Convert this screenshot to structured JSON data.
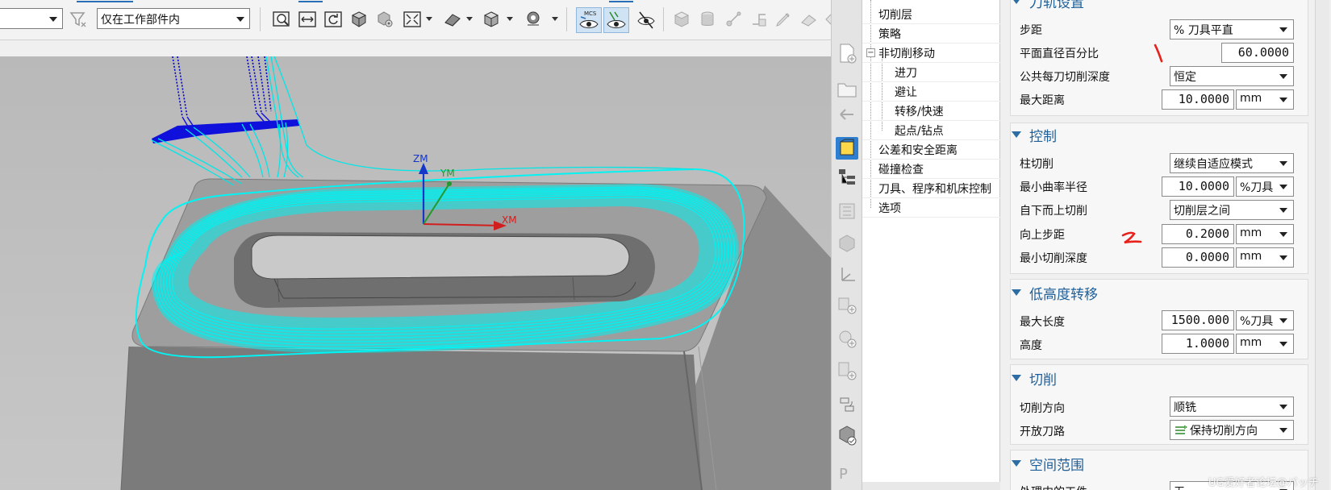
{
  "toolbar": {
    "filter_combo_value": "",
    "scope_combo_value": "仅在工作部件内",
    "mcs_label": "MCS"
  },
  "viewport": {
    "axis_zm": "ZM",
    "axis_ym": "YM",
    "axis_xm": "XM"
  },
  "navigator": {
    "items": [
      {
        "label": "切削层",
        "level": 0
      },
      {
        "label": "策略",
        "level": 0
      },
      {
        "label": "非切削移动",
        "level": 0,
        "expanded": true
      },
      {
        "label": "进刀",
        "level": 1
      },
      {
        "label": "避让",
        "level": 1
      },
      {
        "label": "转移/快速",
        "level": 1
      },
      {
        "label": "起点/钻点",
        "level": 1
      },
      {
        "label": "公差和安全距离",
        "level": 0
      },
      {
        "label": "碰撞检查",
        "level": 0
      },
      {
        "label": "刀具、程序和机床控制",
        "level": 0
      },
      {
        "label": "选项",
        "level": 0
      }
    ]
  },
  "dialog": {
    "sections": {
      "toolpath": {
        "title": "刀轨设置",
        "stepover_label": "步距",
        "stepover_value": "% 刀具平直",
        "flat_pct_label": "平面直径百分比",
        "flat_pct_value": "60.0000",
        "common_depth_label": "公共每刀切削深度",
        "common_depth_value": "恒定",
        "max_dist_label": "最大距离",
        "max_dist_value": "10.0000",
        "max_dist_unit": "mm"
      },
      "control": {
        "title": "控制",
        "column_cut_label": "柱切削",
        "column_cut_value": "继续自适应模式",
        "min_radius_label": "最小曲率半径",
        "min_radius_value": "10.0000",
        "min_radius_unit": "%刀具",
        "bottom_up_label": "自下而上切削",
        "bottom_up_value": "切削层之间",
        "up_step_label": "向上步距",
        "up_step_value": "0.2000",
        "up_step_unit": "mm",
        "min_depth_label": "最小切削深度",
        "min_depth_value": "0.0000",
        "min_depth_unit": "mm"
      },
      "low_transfer": {
        "title": "低高度转移",
        "max_len_label": "最大长度",
        "max_len_value": "1500.000",
        "max_len_unit": "%刀具",
        "height_label": "高度",
        "height_value": "1.0000",
        "height_unit": "mm"
      },
      "cutting": {
        "title": "切削",
        "direction_label": "切削方向",
        "direction_value": "顺铣",
        "open_path_label": "开放刀路",
        "open_path_value": "保持切削方向"
      },
      "spatial": {
        "title": "空间范围",
        "in_process_label": "处理中的工件",
        "in_process_value": "无"
      }
    },
    "annotations": {
      "mark_1": "1",
      "mark_2": "2"
    }
  },
  "watermark": "UG爱好者论坛@バッチ"
}
